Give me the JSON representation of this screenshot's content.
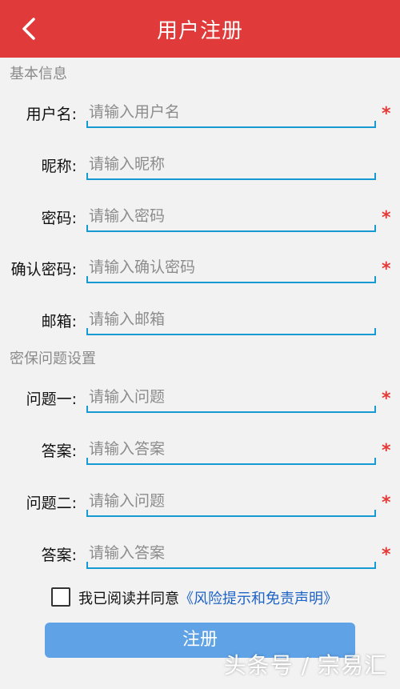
{
  "header": {
    "title": "用户注册",
    "back_icon": "chevron-left-icon",
    "background": "#e03a3a"
  },
  "sections": {
    "basic": "基本信息",
    "security": "密保问题设置"
  },
  "fields": {
    "username": {
      "label": "用户名:",
      "placeholder": "请输入用户名",
      "required": "*"
    },
    "nickname": {
      "label": "昵称:",
      "placeholder": "请输入昵称"
    },
    "password": {
      "label": "密码:",
      "placeholder": "请输入密码",
      "required": "*"
    },
    "confirm_password": {
      "label": "确认密码:",
      "placeholder": "请输入确认密码",
      "required": "*"
    },
    "email": {
      "label": "邮箱:",
      "placeholder": "请输入邮箱"
    },
    "question1": {
      "label": "问题一:",
      "placeholder": "请输入问题",
      "required": "*"
    },
    "answer1": {
      "label": "答案:",
      "placeholder": "请输入答案",
      "required": "*"
    },
    "question2": {
      "label": "问题二:",
      "placeholder": "请输入问题",
      "required": "*"
    },
    "answer2": {
      "label": "答案:",
      "placeholder": "请输入答案",
      "required": "*"
    }
  },
  "agreement": {
    "text": "我已阅读并同意",
    "link": "《风险提示和免责声明》",
    "checked": false
  },
  "register_button": "注册",
  "watermark": "头条号 / 宗易汇",
  "colors": {
    "accent_blue": "#159ad3",
    "required_red": "#e53935",
    "button_blue": "#5fa2e6",
    "link_blue": "#1e63c6"
  }
}
